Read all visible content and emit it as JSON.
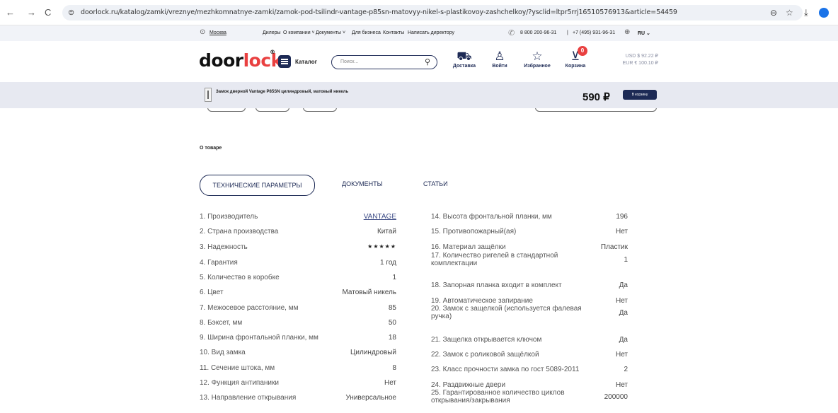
{
  "browser": {
    "url": "doorlock.ru/katalog/zamki/vreznye/mezhkomnatnye-zamki/zamok-pod-tsilindr-vantage-p85sn-matovyy-nikel-s-plastikovoy-zashchelkoy/?ysclid=ltpr5rrj16510576913&article=54459",
    "back": "←",
    "forward": "→",
    "reload": "C",
    "tune": "⊜",
    "zoom": "⊖",
    "star": "☆",
    "download": "⤓"
  },
  "topbar": {
    "pin": "⊙",
    "city": "Москва",
    "links": [
      "Дилеры",
      "О компании ˅",
      "Документы ˅",
      "Для бизнеса",
      "Контакты",
      "Написать директору"
    ],
    "phone_icon": "✆",
    "phone1": "8 800 200-96-31",
    "sep": "|",
    "phone2": "+7 (495) 931-96-31",
    "globe": "⊕",
    "lang": "RU ⌄"
  },
  "header": {
    "logo_door": "door",
    "logo_lock": "lock",
    "logo_reg": "®",
    "catalog": "Каталог",
    "search_placeholder": "Поиск...",
    "search_icon": "⚲",
    "delivery": "Доставка",
    "login": "Войти",
    "favorites": "Избранное",
    "cart": "Корзина",
    "cart_count": "0",
    "icons": {
      "delivery": "⛟",
      "login": "♙",
      "favorites": "☆",
      "cart": "⊻"
    },
    "usd": "USD $ 92.22 ₽",
    "eur": "EUR € 100.10 ₽"
  },
  "sticky": {
    "name": "Замок дверной Vantage P85SN цилиндровый, матовый никель",
    "price": "590 ₽",
    "buy": "В корзину"
  },
  "about": "О товаре",
  "tabs": [
    "ТЕХНИЧЕСКИЕ ПАРАМЕТРЫ",
    "ДОКУМЕНТЫ",
    "СТАТЬИ"
  ],
  "specs_left": [
    {
      "k": "1. Производитель",
      "v": "VANTAGE"
    },
    {
      "k": "2. Страна производства",
      "v": "Китай"
    },
    {
      "k": "3. Надежность",
      "v": "★★★★★"
    },
    {
      "k": "4. Гарантия",
      "v": "1 год"
    },
    {
      "k": "5. Количество в коробке",
      "v": "1"
    },
    {
      "k": "6. Цвет",
      "v": "Матовый никель"
    },
    {
      "k": "7. Межосевое расстояние, мм",
      "v": "85"
    },
    {
      "k": "8. Бэксет, мм",
      "v": "50"
    },
    {
      "k": "9. Ширина фронтальной планки, мм",
      "v": "18"
    },
    {
      "k": "10. Вид замка",
      "v": "Цилиндровый"
    },
    {
      "k": "11. Сечение штока, мм",
      "v": "8"
    },
    {
      "k": "12. Функция антипаники",
      "v": "Нет"
    },
    {
      "k": "13. Направление открывания",
      "v": "Универсальное"
    }
  ],
  "specs_right": [
    {
      "k": "14. Высота фронтальной планки, мм",
      "v": "196"
    },
    {
      "k": "15. Противопожарный(ая)",
      "v": "Нет"
    },
    {
      "k": "16. Материал защёлки",
      "v": "Пластик"
    },
    {
      "k": "17. Количество ригелей в стандартной комплектации",
      "v": "1"
    },
    {
      "k": "18. Запорная планка входит в комплект",
      "v": "Да"
    },
    {
      "k": "19. Автоматическое запирание",
      "v": "Нет"
    },
    {
      "k": "20. Замок с защелкой (используется фалевая ручка)",
      "v": "Да"
    },
    {
      "k": "21. Защелка открывается ключом",
      "v": "Да"
    },
    {
      "k": "22. Замок с роликовой защёлкой",
      "v": "Нет"
    },
    {
      "k": "23. Класс прочности замка по гост 5089-2011",
      "v": "2"
    },
    {
      "k": "24. Раздвижные двери",
      "v": "Нет"
    },
    {
      "k": "25. Гарантированное количество циклов открывания/закрывания",
      "v": "200000"
    }
  ]
}
